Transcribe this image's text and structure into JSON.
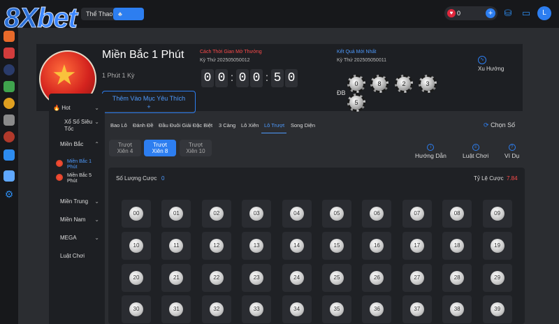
{
  "logo": {
    "part1": "8X",
    "part2": "bet"
  },
  "top_tabs": {
    "sport": "Thể Thao"
  },
  "balance": {
    "value": "0"
  },
  "avatar": "L",
  "game": {
    "title": "Miền Bắc 1 Phút",
    "subtitle": "1 Phút 1 Kỳ",
    "fav_button": "Thêm Vào Mục Yêu Thích",
    "fav_plus": "+"
  },
  "countdown": {
    "label": "Cách Thời Gian Mở Thưởng",
    "period": "Kỳ Thứ 202505050012",
    "digits": [
      "0",
      "0",
      "0",
      "0",
      "5",
      "0"
    ]
  },
  "result": {
    "label": "Kết Quả Mới Nhất",
    "period": "Kỳ Thứ 202505050011",
    "db_label": "ĐB",
    "balls": [
      "0",
      "8",
      "2",
      "3",
      "5"
    ]
  },
  "trend": "Xu Hướng",
  "side": {
    "hot": "Hot",
    "xoso": "Xổ Số Siêu Tốc",
    "mienbac": "Miền Bắc",
    "sub1": "Miền Bắc 1 Phút",
    "sub2": "Miền Bắc 5 Phút",
    "mientrung": "Miền Trung",
    "miennam": "Miền Nam",
    "mega": "MEGA",
    "luat": "Luật Chơi"
  },
  "tabs": [
    "Bao Lô",
    "Đánh Đề",
    "Đầu Đuôi Giải Đặc Biệt",
    "3 Càng",
    "Lô Xiên",
    "Lô Trượt",
    "Song Diện"
  ],
  "choose": "Chọn Số",
  "subtabs": [
    {
      "line1": "Trượt",
      "line2": "Xiên 4"
    },
    {
      "line1": "Trượt",
      "line2": "Xiên 8"
    },
    {
      "line1": "Trượt",
      "line2": "Xiên 10"
    }
  ],
  "help": {
    "guide": "Hướng Dẫn",
    "rules": "Luật Chơi",
    "example": "Ví Dụ"
  },
  "board": {
    "count_label": "Số Lượng Cược",
    "count_value": "0",
    "rate_label": "Tỷ Lệ Cược",
    "rate_value": "7.84",
    "numbers": [
      "00",
      "01",
      "02",
      "03",
      "04",
      "05",
      "06",
      "07",
      "08",
      "09",
      "10",
      "11",
      "12",
      "13",
      "14",
      "15",
      "16",
      "17",
      "18",
      "19",
      "20",
      "21",
      "22",
      "23",
      "24",
      "25",
      "26",
      "27",
      "28",
      "29",
      "30",
      "31",
      "32",
      "33",
      "34",
      "35",
      "36",
      "37",
      "38",
      "39"
    ]
  },
  "colors": {
    "accent": "#2d7ef0",
    "danger": "#ff4b4b",
    "bg": "#2b2d31"
  },
  "icons": [
    "heart-icon",
    "plus-icon",
    "wallet-icon",
    "card-icon",
    "chart-icon",
    "info-icon",
    "help-icon",
    "fire-icon"
  ]
}
